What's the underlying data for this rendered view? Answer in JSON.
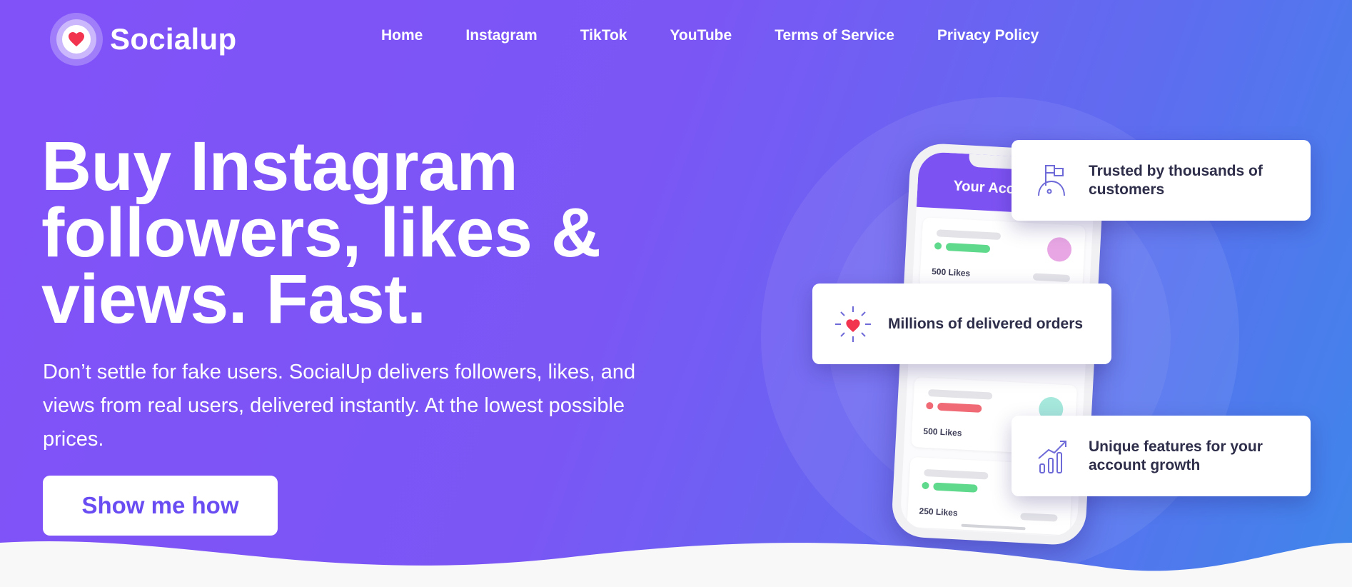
{
  "brand": {
    "name": "Socialup",
    "icon": "heart-icon"
  },
  "nav": {
    "items": [
      "Home",
      "Instagram",
      "TikTok",
      "YouTube",
      "Terms of Service",
      "Privacy Policy"
    ]
  },
  "hero": {
    "title": "Buy Instagram followers, likes & views. Fast.",
    "subtitle": "Don’t settle for fake users. SocialUp delivers followers, likes, and views from real users, delivered instantly. At the lowest possible prices.",
    "cta": "Show me how"
  },
  "phone": {
    "header": "Your Account",
    "posts": [
      {
        "likes": "500 Likes",
        "accent": "#5fd98b",
        "circle": "#e8a6e4"
      },
      {
        "likes": "500 Likes",
        "accent": "#f06a75",
        "circle": "#a6e8dc"
      },
      {
        "likes": "250 Likes",
        "accent": "#5fd98b",
        "circle": "#ffffff"
      }
    ]
  },
  "features": [
    {
      "text": "Trusted by thousands of customers",
      "icon": "flag-icon"
    },
    {
      "text": "Millions of delivered orders",
      "icon": "sparkle-heart-icon"
    },
    {
      "text": "Unique features for your account growth",
      "icon": "growth-chart-icon"
    }
  ],
  "colors": {
    "accent": "#7b56f5",
    "heart": "#f2344f",
    "cta_text": "#6a4cf3",
    "card_text": "#2e2e4a"
  }
}
